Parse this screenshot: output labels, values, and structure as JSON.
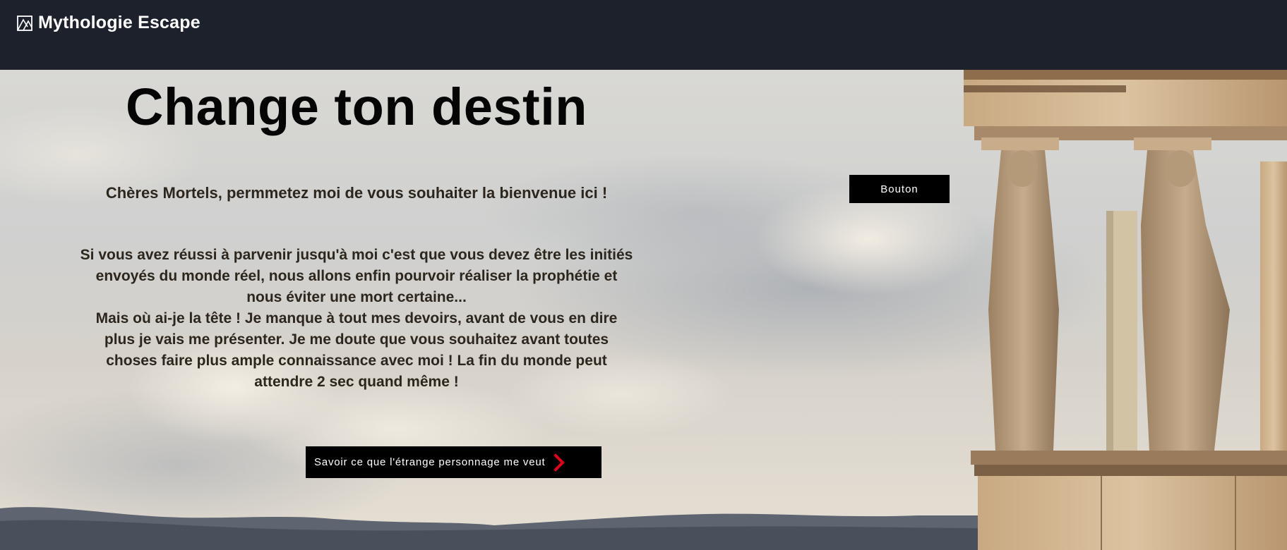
{
  "header": {
    "site_title": "Mythologie Escape"
  },
  "hero": {
    "title": "Change ton destin",
    "intro": "Chères Mortels, permmetez moi de vous souhaiter la bienvenue ici !",
    "body_paragraphs": [
      "Si vous avez réussi à parvenir jusqu'à moi c'est que vous devez être les initiés envoyés du monde réel, nous allons enfin pourvoir réaliser la prophétie et nous éviter une mort certaine...",
      "Mais où ai-je la tête ! Je manque à tout mes devoirs, avant de vous en dire plus je vais me présenter. Je me doute que vous souhaitez avant toutes choses faire plus ample connaissance avec moi !  La fin du monde peut attendre 2 sec quand même !"
    ],
    "button_label": "Bouton",
    "cta_label": "Savoir ce que l'étrange personnage me veut"
  },
  "icons": {
    "logo": "mountain-logo-icon",
    "cta_arrow": "chevron-right-icon"
  },
  "colors": {
    "header_bg": "#1d212b",
    "button_bg": "#000000",
    "arrow_accent": "#e3001b",
    "text_dark": "#2c261d"
  }
}
